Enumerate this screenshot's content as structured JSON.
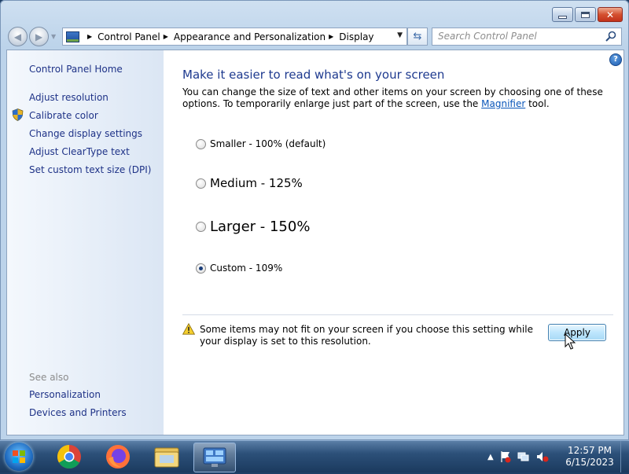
{
  "window": {
    "controls": {
      "minimize": "minimize",
      "maximize": "maximize",
      "close": "✕"
    }
  },
  "address_bar": {
    "crumbs": [
      "Control Panel",
      "Appearance and Personalization",
      "Display"
    ]
  },
  "search": {
    "placeholder": "Search Control Panel"
  },
  "sidebar": {
    "home": "Control Panel Home",
    "tasks": [
      "Adjust resolution",
      "Calibrate color",
      "Change display settings",
      "Adjust ClearType text",
      "Set custom text size (DPI)"
    ],
    "see_also_label": "See also",
    "see_also": [
      "Personalization",
      "Devices and Printers"
    ]
  },
  "main": {
    "title": "Make it easier to read what's on your screen",
    "description_before": "You can change the size of text and other items on your screen by choosing one of these options. To temporarily enlarge just part of the screen, use the ",
    "description_link": "Magnifier",
    "description_after": " tool.",
    "options": [
      {
        "label": "Smaller - 100% (default)",
        "checked": false
      },
      {
        "label": "Medium - 125%",
        "checked": false
      },
      {
        "label": "Larger - 150%",
        "checked": false
      },
      {
        "label": "Custom - 109%",
        "checked": true
      }
    ],
    "warning": "Some items may not fit on your screen if you choose this setting while your display is set to this resolution.",
    "apply_label": "Apply"
  },
  "taskbar": {
    "apps": [
      "start-orb",
      "chrome",
      "firefox",
      "file-explorer",
      "control-panel"
    ],
    "clock_time": "12:57 PM",
    "clock_date": "6/15/2023"
  },
  "colors": {
    "title_blue": "#1e3a8f",
    "link_blue": "#1e3287",
    "accent": "#0a56b9"
  }
}
